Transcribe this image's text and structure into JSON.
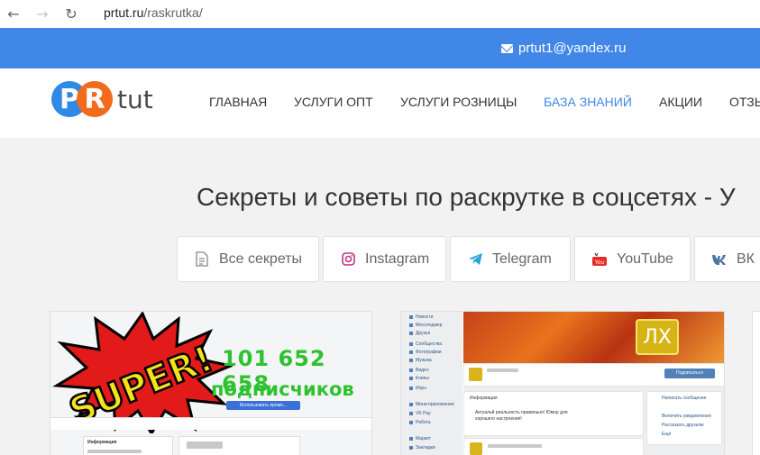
{
  "browser": {
    "back_icon": "arrow-left-icon",
    "forward_icon": "arrow-right-icon",
    "reload_icon": "reload-icon",
    "url_host": "prtut.ru",
    "url_path": "/raskrutka/"
  },
  "topbar": {
    "email": "prtut1@yandex.ru",
    "email_icon": "envelope-icon",
    "bg_color": "#4087e8"
  },
  "logo": {
    "p": "P",
    "r": "R",
    "tut": "tut"
  },
  "menu": {
    "items": [
      {
        "label": "Главная"
      },
      {
        "label": "Услуги опт"
      },
      {
        "label": "Услуги розницы"
      },
      {
        "label": "База знаний"
      },
      {
        "label": "Акции"
      },
      {
        "label": "Отзывы"
      }
    ],
    "active_color": "#4087e8"
  },
  "headline": "Секреты и советы по раскрутке в соцсетях - У",
  "filters": [
    {
      "label": "Все секреты",
      "icon": "document-icon"
    },
    {
      "label": "Instagram",
      "icon": "instagram-icon"
    },
    {
      "label": "Telegram",
      "icon": "telegram-icon"
    },
    {
      "label": "YouTube",
      "icon": "youtube-icon"
    },
    {
      "label": "ВК",
      "icon": "vk-icon"
    }
  ],
  "card1": {
    "burst_text": "SUPER!",
    "count": "101 652 658",
    "subs_word": "подписчиков",
    "button": "Использовать промо...",
    "panel_title": "Информация"
  },
  "card2": {
    "cover_text": "ЛХ",
    "subscribe": "Подписаться",
    "info_title": "Информация",
    "status": "Актуальй реальность правильно! Юмор для хорошего настроения!",
    "sidebar": [
      "Новости",
      "Мессенджер",
      "Друзья",
      "Сообщества",
      "Фотографии",
      "Музыка",
      "Видео",
      "Клипы",
      "Игры",
      "Мини-приложения",
      "VK Pay",
      "Работа",
      "Маркет",
      "Закладки"
    ],
    "actions": [
      "Написать сообщение",
      "Включить уведомления",
      "Рассказать друзьям",
      "Ещё"
    ]
  }
}
